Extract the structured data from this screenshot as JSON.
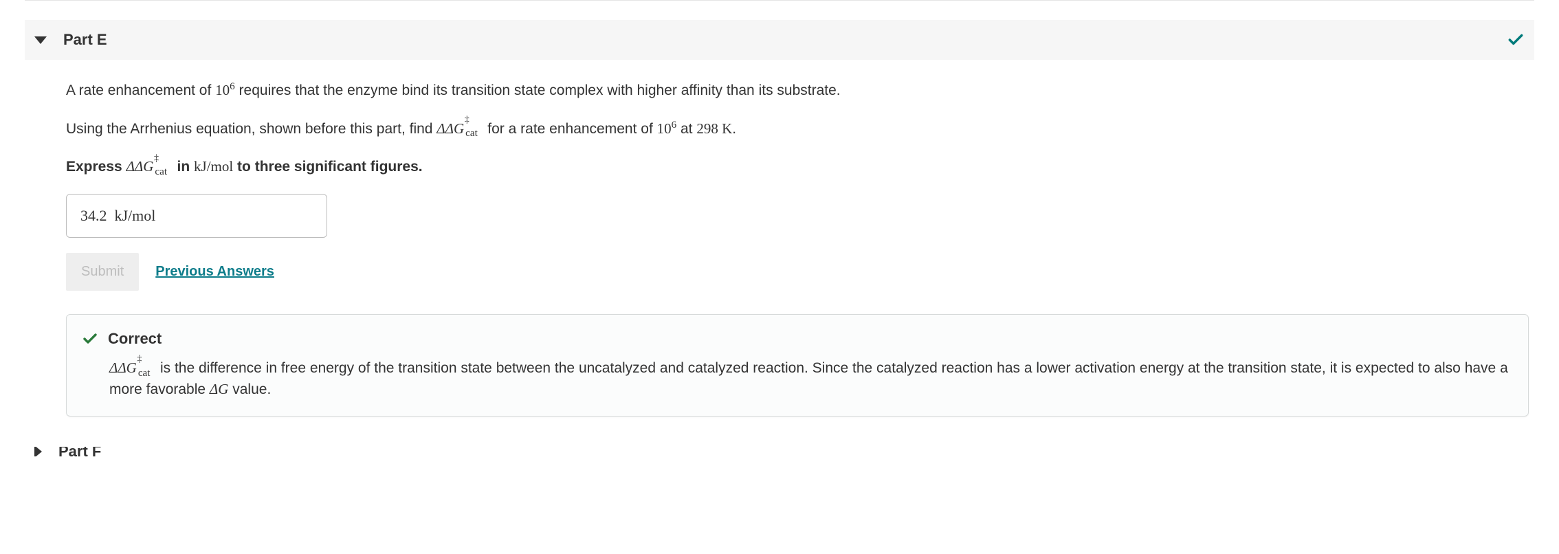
{
  "part": {
    "title": "Part E",
    "completed": true
  },
  "question": {
    "para1_before": "A rate enhancement of ",
    "para1_exp_base": "10",
    "para1_exp_sup": "6",
    "para1_after": " requires that the enzyme bind its transition state complex with higher affinity than its substrate.",
    "para2_before": "Using the Arrhenius equation, shown before this part, find ",
    "ddg_main": "ΔΔG",
    "ddg_dagger": "‡",
    "ddg_sub": "cat",
    "para2_mid": " for a rate enhancement of ",
    "para2_exp_base": "10",
    "para2_exp_sup": "6",
    "para2_at": " at ",
    "para2_temp_val": "298",
    "para2_temp_unit": " K",
    "para2_end": ".",
    "express_before": "Express ",
    "express_in": " in ",
    "express_units": "kJ/mol",
    "express_after": " to three significant figures."
  },
  "answer": {
    "value": "34.2",
    "spaces": "  ",
    "units": "kJ/mol"
  },
  "buttons": {
    "submit": "Submit",
    "previous": "Previous Answers"
  },
  "feedback": {
    "title": "Correct",
    "body_mid": " is the difference in free energy of the transition state between the uncatalyzed and catalyzed reaction. Since the catalyzed reaction has a lower activation energy at the transition state, it is expected to also have a more favorable ",
    "dg": "ΔG",
    "body_after": " value."
  },
  "next_part": {
    "title": "Part F"
  }
}
